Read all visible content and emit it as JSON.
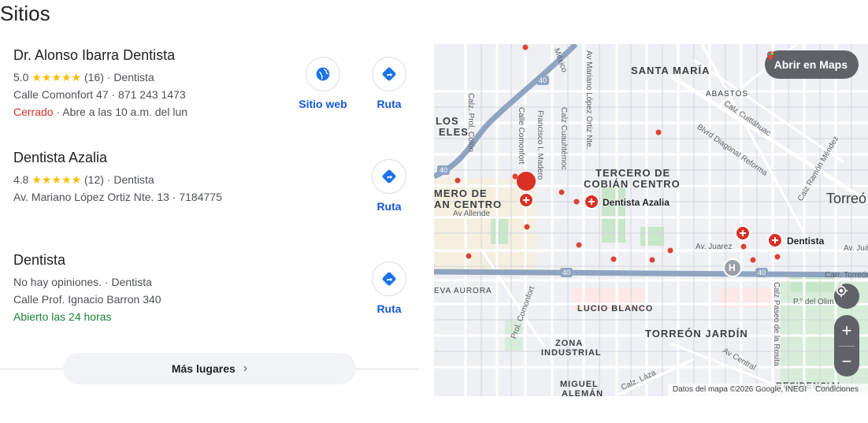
{
  "heading": "Sitios",
  "places": [
    {
      "name": "Dr. Alonso Ibarra Dentista",
      "rating": "5.0",
      "stars": "★★★★★",
      "reviews": "(16)",
      "category": "Dentista",
      "address_phone": "Calle Comonfort 47 · 871 243 1473",
      "status": "Cerrado",
      "hours": "Abre a las 10 a.m. del lun",
      "website_label": "Sitio web",
      "directions_label": "Ruta"
    },
    {
      "name": "Dentista Azalia",
      "rating": "4.8",
      "stars": "★★★★★",
      "reviews": "(12)",
      "category": "Dentista",
      "address_phone": "Av. Mariano López Ortiz Nte. 13 · 7184775",
      "directions_label": "Ruta"
    },
    {
      "name": "Dentista",
      "no_reviews": "No hay opiniones.",
      "category": "Dentista",
      "address": "Calle Prof. Ignacio Barron 340",
      "status": "Abierto las 24 horas",
      "directions_label": "Ruta"
    }
  ],
  "more_places": "Más lugares",
  "map": {
    "open_in_maps": "Abrir en Maps",
    "attribution": "Datos del mapa ©2026 Google, INEGI",
    "terms": "Condiciones",
    "pin_labels": [
      "Dentista Azalia",
      "Dentista"
    ],
    "areas": [
      "SANTA MARÍA",
      "TERCERO DE",
      "COBIÁN CENTRO",
      "TORREÓN JARDÍN",
      "ZONA",
      "INDUSTRIAL",
      "LUCIO BLANCO",
      "MIGUEL",
      "ALEMÁN",
      "ABASTOS",
      "Torreó",
      "MERO DE",
      "AN CENTRO",
      "LOS",
      "ELES",
      "EVA AURORA",
      "RESIDENCIAL"
    ],
    "streets": [
      "Calz Cuauhtémoc",
      "Av Mariano López Ortiz Nte.",
      "Francisco I. Madero",
      "Calle Comonfort",
      "Calz. Prol. Colón",
      "México",
      "Calz Cuitláhuac",
      "Blvrd Diagonal Reforma",
      "Calz Ramón Méndez",
      "Av Allende",
      "Av. Juarez",
      "Av. Juá",
      "Carr. Torreón",
      "P.° del Olim",
      "Calz Paseo de la Rosita",
      "Av Central",
      "Prol. Comonfort",
      "Calz. Láza"
    ],
    "highway_marker": "40",
    "hospital_marker": "H"
  }
}
